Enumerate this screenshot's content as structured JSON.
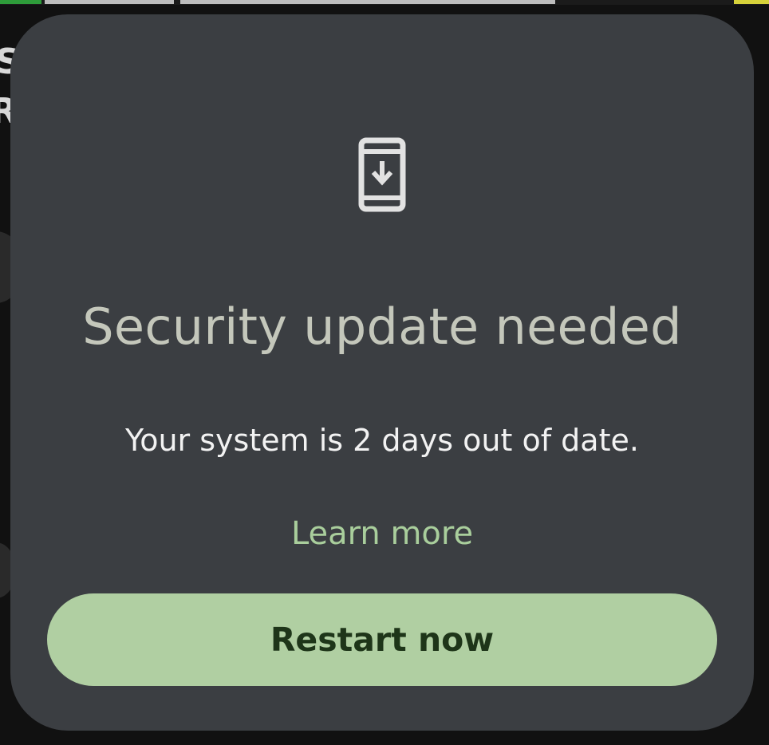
{
  "dialog": {
    "icon": "phone-download-icon",
    "title": "Security update needed",
    "message": "Your system is 2 days out of date.",
    "learn_more_label": "Learn more",
    "restart_label": "Restart now"
  },
  "colors": {
    "dialog_background": "#3b3e42",
    "title_text": "#c4c7bb",
    "message_text": "#f2f2f2",
    "link_text": "#a9ce9c",
    "button_background": "#b0cfa2",
    "button_text": "#1e3519"
  }
}
